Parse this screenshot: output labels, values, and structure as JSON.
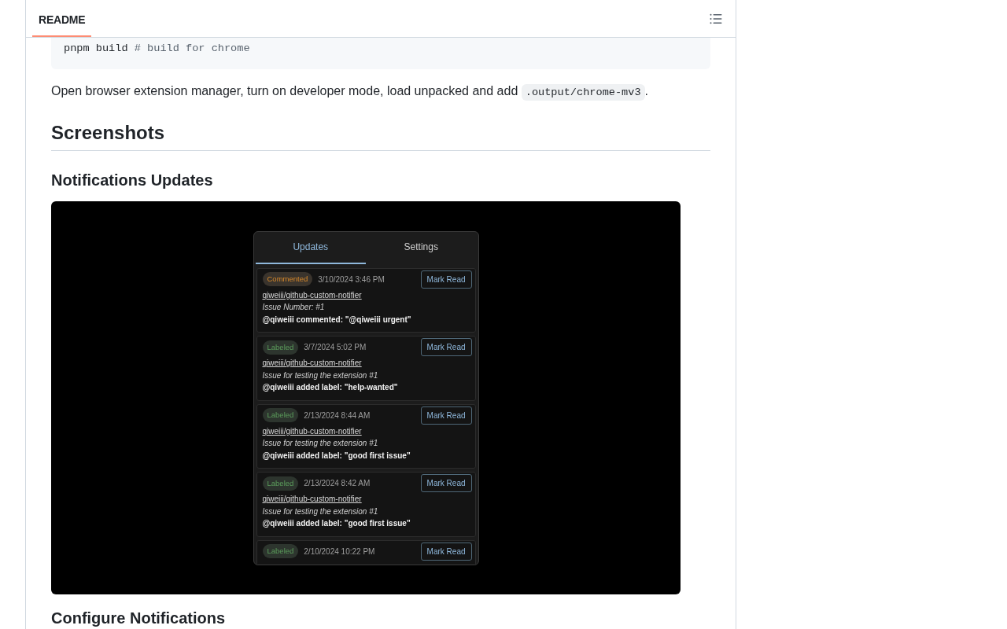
{
  "readme_header": {
    "tabs": [
      {
        "label": "README",
        "selected": true
      }
    ]
  },
  "code_block": {
    "lines": [
      {
        "code": "pnpm build",
        "comment": "# build for chrome"
      }
    ]
  },
  "paragraph": {
    "text": "Open browser extension manager, turn on developer mode, load unpacked and add",
    "code": ".output/chrome-mv3",
    "end": "."
  },
  "section": {
    "heading": "Screenshots",
    "subsections": [
      {
        "heading": "Notifications Updates",
        "screenshot": {
          "tabs": [
            {
              "label": "Updates",
              "selected": true
            },
            {
              "label": "Settings",
              "selected": false
            }
          ],
          "notifications": [
            {
              "kind": "commented",
              "event": "Commented",
              "time": "3/10/2024 3:46 PM",
              "action": "Mark Read",
              "repo": "qiweiii/github-custom-notifier",
              "title": "Issue Number: #1",
              "message": "@qiweiii commented: \"@qiweiii urgent\""
            },
            {
              "kind": "labeled",
              "event": "Labeled",
              "time": "3/7/2024 5:02 PM",
              "action": "Mark Read",
              "repo": "qiweiii/github-custom-notifier",
              "title": "Issue for testing the extension #1",
              "message": "@qiweiii added label: \"help-wanted\""
            },
            {
              "kind": "labeled",
              "event": "Labeled",
              "time": "2/13/2024 8:44 AM",
              "action": "Mark Read",
              "repo": "qiweiii/github-custom-notifier",
              "title": "Issue for testing the extension #1",
              "message": "@qiweiii added label: \"good first issue\""
            },
            {
              "kind": "labeled",
              "event": "Labeled",
              "time": "2/13/2024 8:42 AM",
              "action": "Mark Read",
              "repo": "qiweiii/github-custom-notifier",
              "title": "Issue for testing the extension #1",
              "message": "@qiweiii added label: \"good first issue\""
            },
            {
              "kind": "labeled",
              "event": "Labeled",
              "time": "2/10/2024 10:22 PM",
              "action": "Mark Read"
            }
          ]
        }
      },
      {
        "heading": "Configure Notifications"
      }
    ]
  }
}
